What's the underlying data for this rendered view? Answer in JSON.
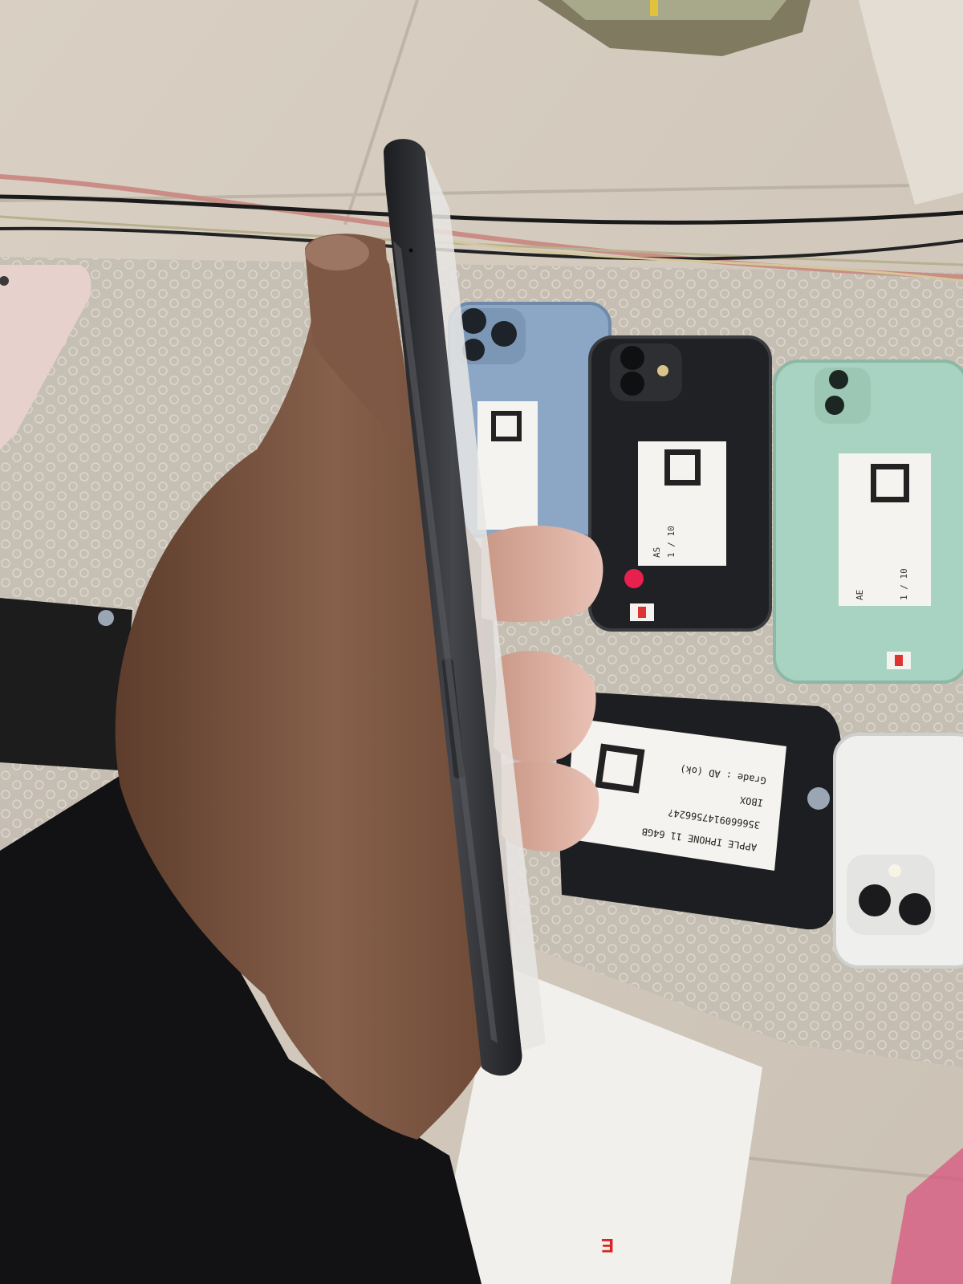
{
  "scene": {
    "colors": {
      "floor": "#d4cbbd",
      "bubble_wrap": "#bdb6ac",
      "phone_black": "#26282b",
      "phone_blue": "#8aa6c4",
      "phone_green": "#a9d3c2",
      "phone_white": "#eeeeec",
      "phone_pink": "#e8d3cf",
      "skin": "#7a5340",
      "sleeve": "#121214",
      "red_sticker": "#e8204e"
    },
    "labels": {
      "label_a": {
        "grade": "AS",
        "unit": "1 / 10"
      },
      "label_b": {
        "grade": "AE",
        "unit": "1 / 10"
      },
      "label_c": {
        "model": "APPLE IPHONE 11 64GB",
        "serial": "356660914756624?",
        "box": "IBOX",
        "grade": "Grade : AD (ok)"
      }
    },
    "card": {
      "mark": "E"
    }
  }
}
